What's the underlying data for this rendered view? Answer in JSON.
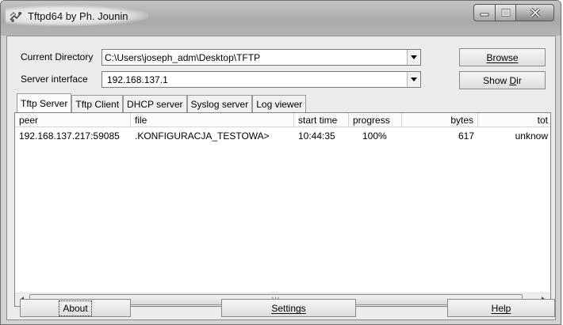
{
  "window": {
    "title": "Tftpd64 by Ph. Jounin"
  },
  "settings_area": {
    "current_directory_label": "Current Directory",
    "current_directory_value": "C:\\Users\\joseph_adm\\Desktop\\TFTP",
    "server_interface_label": "Server interface",
    "server_interface_value": "192.168.137.1",
    "browse_label": "Browse",
    "show_dir_label_prefix": "Show ",
    "show_dir_label_accel": "D",
    "show_dir_label_suffix": "ir"
  },
  "tabs": [
    {
      "label": "Tftp Server",
      "active": true
    },
    {
      "label": "Tftp Client",
      "active": false
    },
    {
      "label": "DHCP server",
      "active": false
    },
    {
      "label": "Syslog server",
      "active": false
    },
    {
      "label": "Log viewer",
      "active": false
    }
  ],
  "transfer_table": {
    "columns": [
      "peer",
      "file",
      "start time",
      "progress",
      "bytes",
      "tot"
    ],
    "rows": [
      {
        "peer": "192.168.137.217:59085",
        "file": ".KONFIGURACJA_TESTOWA>",
        "start_time": "10:44:35",
        "progress": "100%",
        "bytes": "617",
        "total": "unknow"
      }
    ],
    "scroll_grip": "III"
  },
  "bottom_buttons": {
    "about": "About",
    "settings": "Settings",
    "help": "Help"
  },
  "colors": {
    "window_background": "#ececec",
    "titlebar": "#b3b3b3",
    "list_background": "#ffffff"
  },
  "icons": [
    "app-icon",
    "minimize-icon",
    "maximize-icon",
    "close-icon",
    "chevron-down-icon",
    "scroll-left-icon",
    "scroll-right-icon"
  ]
}
